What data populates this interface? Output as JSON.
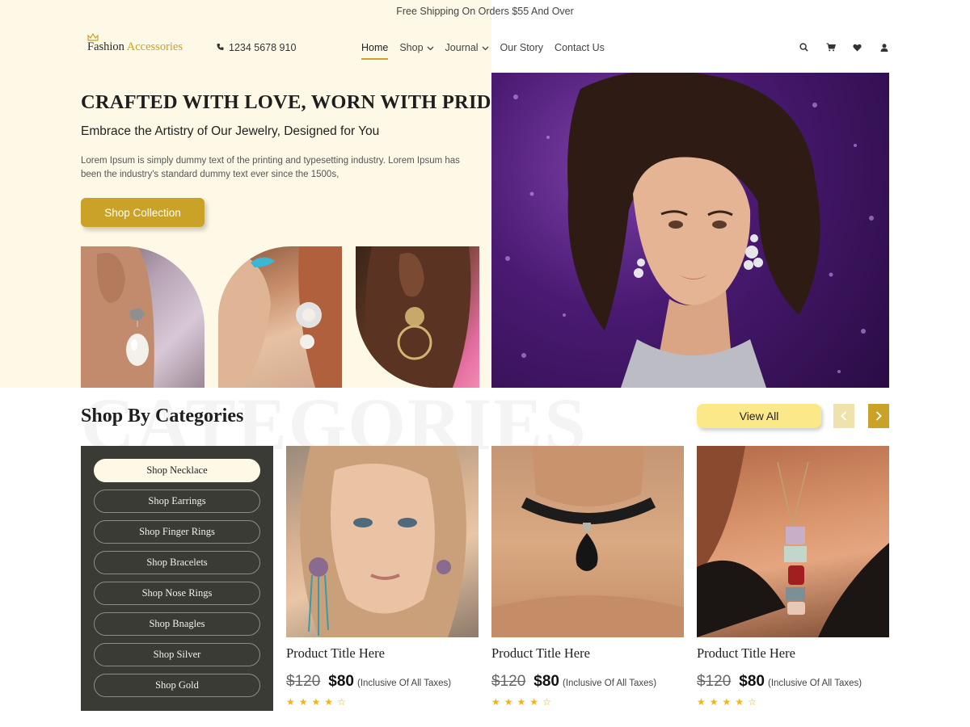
{
  "promo": {
    "text": "Free Shipping On Orders $55 And Over"
  },
  "header": {
    "brand_part1": "Fashion",
    "brand_part2": "Accessories",
    "phone": "1234 5678 910",
    "nav": [
      {
        "label": "Home",
        "active": true
      },
      {
        "label": "Shop",
        "dropdown": true
      },
      {
        "label": "Journal",
        "dropdown": true
      },
      {
        "label": "Our Story"
      },
      {
        "label": "Contact Us"
      }
    ],
    "icons": [
      "search-icon",
      "cart-icon",
      "heart-icon",
      "user-icon"
    ]
  },
  "hero": {
    "title": "CRAFTED WITH LOVE, WORN WITH PRIDE",
    "subtitle": "Embrace the Artistry of Our Jewelry, Designed for You",
    "description": "Lorem Ipsum is simply dummy text of the printing and typesetting industry. Lorem Ipsum has been the industry's standard dummy text ever since the 1500s,",
    "cta_label": "Shop Collection"
  },
  "categories": {
    "watermark": "CATEGORIES",
    "title": "Shop By Categories",
    "view_all_label": "View All",
    "items": [
      {
        "label": "Shop Necklace",
        "active": true
      },
      {
        "label": "Shop Earrings"
      },
      {
        "label": "Shop Finger Rings"
      },
      {
        "label": "Shop Bracelets"
      },
      {
        "label": "Shop Nose Rings"
      },
      {
        "label": "Shop Bnagles"
      },
      {
        "label": "Shop Silver"
      },
      {
        "label": "Shop Gold"
      }
    ]
  },
  "products": [
    {
      "title": "Product Title Here",
      "old_price": "$120",
      "price": "$80",
      "tax_note": "(Inclusive Of All Taxes)",
      "rating": 4,
      "rating_max": 5
    },
    {
      "title": "Product Title Here",
      "old_price": "$120",
      "price": "$80",
      "tax_note": "(Inclusive Of All Taxes)",
      "rating": 4,
      "rating_max": 5
    },
    {
      "title": "Product Title Here",
      "old_price": "$120",
      "price": "$80",
      "tax_note": "(Inclusive Of All Taxes)",
      "rating": 4,
      "rating_max": 5
    }
  ],
  "colors": {
    "accent": "#c9a227",
    "hero_background": "#fef9e6",
    "view_all_button": "#fbe889",
    "category_panel": "#3b3b36",
    "star": "#f2b21c"
  }
}
